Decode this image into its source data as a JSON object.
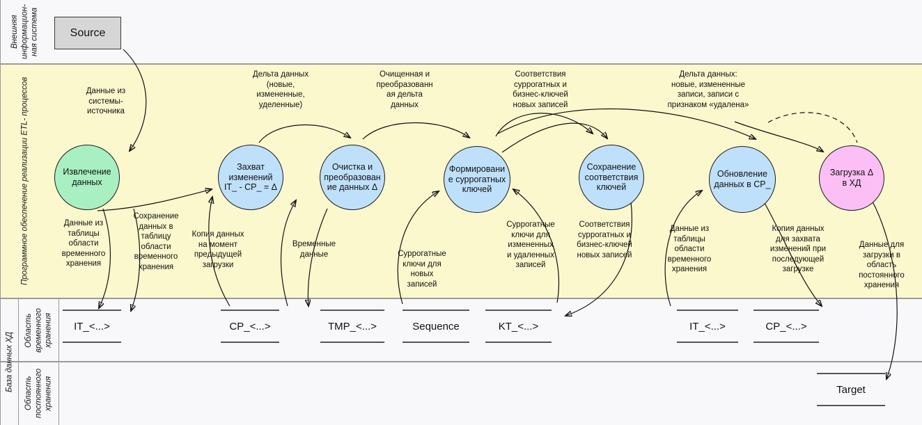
{
  "diagram": {
    "title": "ETL process dataflow diagram"
  },
  "lanes": [
    {
      "id": "external",
      "label": "Внешняя\nинформацион-\nная система"
    },
    {
      "id": "etl",
      "label": "Программное обеспечение реализации ETL-\nпроцессов"
    },
    {
      "id": "database",
      "label": "База данных ХД"
    },
    {
      "id": "temporary",
      "label": "Область\nвременного\nхранения"
    },
    {
      "id": "permanent",
      "label": "Область\nпостоянного\nхранения"
    }
  ],
  "source_box": {
    "label": "Source"
  },
  "nodes": [
    {
      "id": "extract",
      "label": "Извлечение\nданных",
      "color": "#a8f0c2"
    },
    {
      "id": "capture",
      "label": "Захват\nизменений\nIT_ - CP_ = Δ",
      "color": "#bfe0fb"
    },
    {
      "id": "cleanse",
      "label": "Очистка и\nпреобразован\nие данных Δ",
      "color": "#bfe0fb"
    },
    {
      "id": "surrogate",
      "label": "Формировани\nе суррогатных\nключей",
      "color": "#bfe0fb"
    },
    {
      "id": "keymatch",
      "label": "Сохранение\nсоответствия\nключей",
      "color": "#bfe0fb"
    },
    {
      "id": "update",
      "label": "Обновление\nданных в CP_",
      "color": "#bfe0fb"
    },
    {
      "id": "load",
      "label": "Загрузка Δ\nв ХД",
      "color": "#fbbff6"
    }
  ],
  "stores_temporary": [
    {
      "id": "it-left",
      "label": "IT_<...>"
    },
    {
      "id": "cp-left",
      "label": "CP_<...>"
    },
    {
      "id": "tmp",
      "label": "TMP_<...>"
    },
    {
      "id": "sequence",
      "label": "Sequence"
    },
    {
      "id": "kt",
      "label": "KT_<...>"
    },
    {
      "id": "it-right",
      "label": "IT_<...>"
    },
    {
      "id": "cp-right",
      "label": "CP_<...>"
    }
  ],
  "stores_permanent": [
    {
      "id": "target",
      "label": "Target"
    }
  ],
  "annotations": [
    {
      "id": "source-data",
      "label": "Данные из\nсистемы-\nисточника"
    },
    {
      "id": "delta-data",
      "label": "Дельта данных\n(новые,\nизмененные,\nуделенные)"
    },
    {
      "id": "cleaned-delta",
      "label": "Очищенная и\nпреобразованн\nая дельта\nданных"
    },
    {
      "id": "key-matches-new",
      "label": "Соответствия\nсуррогатных и\nбизнес-ключей\nновых записей"
    },
    {
      "id": "delta-records",
      "label": "Дельта данных:\nновые, измененные\nзаписи, записи с\nпризнаком «удалена»"
    },
    {
      "id": "data-from-temp-1",
      "label": "Данные из\nтаблицы\nобласти\nвременного\nхранения"
    },
    {
      "id": "save-to-temp",
      "label": "Сохранение\nданных в\nтаблицу\nобласти\nвременного\nхранения"
    },
    {
      "id": "copy-prev-load",
      "label": "Копия данных\nна момент\nпредыдущей\nзагрузки"
    },
    {
      "id": "temp-data",
      "label": "Временные\nданные"
    },
    {
      "id": "surrogate-new",
      "label": "Суррогатные\nключи для\nновых\nзаписей"
    },
    {
      "id": "surrogate-changed",
      "label": "Суррогатные\nключи для\nизмененных\nи удаленных\nзаписей"
    },
    {
      "id": "key-matches-new-2",
      "label": "Соответствия\nсуррогатных и\nбизнес-ключей\nновых записей"
    },
    {
      "id": "data-from-temp-2",
      "label": "Данные из\nтаблицы\nобласти\nвременного\nхранения"
    },
    {
      "id": "copy-for-capture",
      "label": "Копия данных\nдля захвата\nизменений при\nпоследующей\nзагрузке"
    },
    {
      "id": "data-for-perm",
      "label": "Данные для\nзагрузки в\nобласть\nпостоянного\nхранения"
    }
  ],
  "colors": {
    "band_etl": "#fbf8cd",
    "band_plain": "#f8f8fa",
    "node_green": "#a8f0c2",
    "node_blue": "#bfe0fb",
    "node_pink": "#fbbff6",
    "source_box": "#d6d6d6",
    "stroke": "#111111"
  }
}
